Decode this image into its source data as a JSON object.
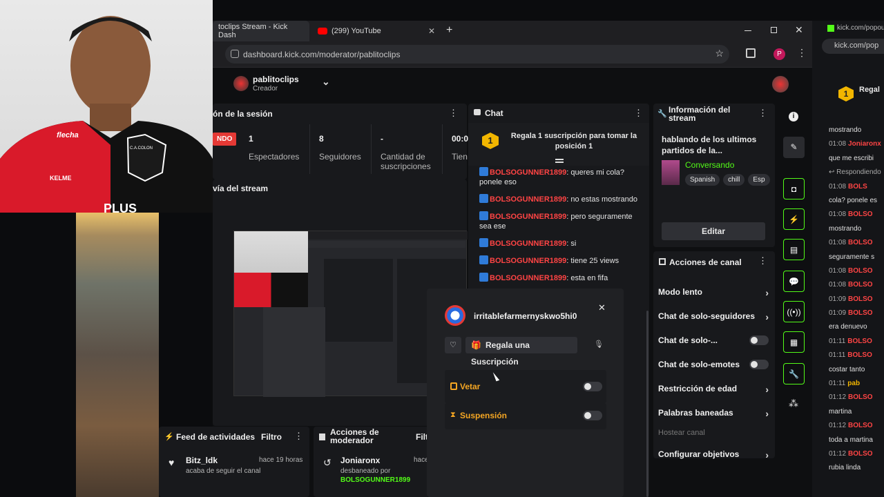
{
  "tabs": [
    {
      "label": "toclips Stream - Kick Dash",
      "close": "✕"
    },
    {
      "label": "(299) YouTube",
      "close": "✕"
    }
  ],
  "new_tab": "+",
  "address": "dashboard.kick.com/moderator/pablitoclips",
  "profile_initial": "P",
  "channel": {
    "name": "pablitoclips",
    "role": "Creador"
  },
  "session": {
    "title": "ón de la sesión",
    "badge": "NDO",
    "stats": [
      {
        "value": "1",
        "label": "Espectadores"
      },
      {
        "value": "8",
        "label": "Seguidores"
      },
      {
        "value": "-",
        "label": "Cantidad de suscripciones"
      },
      {
        "value": "00:0",
        "label": "Tien"
      }
    ]
  },
  "preview_title": "vía del stream",
  "chat": {
    "title": "Chat",
    "pinned": "Regala 1 suscripción para tomar la posición 1",
    "pinned_rank": "1",
    "messages": [
      {
        "user": "BOLSOGUNNER1899",
        "text": ": queres mi cola? ponele eso"
      },
      {
        "user": "BOLSOGUNNER1899",
        "text": ": no estas mostrando"
      },
      {
        "user": "BOLSOGUNNER1899",
        "text": ": pero seguramente sea ese"
      },
      {
        "user": "BOLSOGUNNER1899",
        "text": ": si"
      },
      {
        "user": "BOLSOGUNNER1899",
        "text": ": tiene 25 views"
      },
      {
        "user": "BOLSOGUNNER1899",
        "text": ": esta en fifa"
      }
    ]
  },
  "stream_info": {
    "title": "Información del stream",
    "stream_title": "hablando de los ultimos partidos de la...",
    "category": "Conversando",
    "tags": [
      "Spanish",
      "chill",
      "Esp"
    ],
    "edit_label": "Editar"
  },
  "channel_actions": {
    "title": "Acciones de canal",
    "items": [
      {
        "label": "Modo lento",
        "kind": "chevron"
      },
      {
        "label": "Chat de solo-seguidores",
        "kind": "chevron"
      },
      {
        "label": "Chat de solo-...",
        "kind": "toggle"
      },
      {
        "label": "Chat de solo-emotes",
        "kind": "toggle"
      },
      {
        "label": "Restricción de edad",
        "kind": "chevron"
      },
      {
        "label": "Palabras baneadas",
        "kind": "chevron"
      },
      {
        "label": "Hostear canal",
        "kind": "disabled"
      },
      {
        "label": "Configurar objetivos",
        "kind": "chevron"
      }
    ]
  },
  "activity": {
    "title": "Feed de actividades",
    "filter": "Filtro",
    "user": "Bitz_ldk",
    "time": "hace 19 horas",
    "action": "acaba de seguir el canal"
  },
  "mod_actions": {
    "title": "Acciones de moderador",
    "filter": "Filt",
    "user": "Joniaronx",
    "time": "hace",
    "action": "desbaneado por",
    "by": "BOLSOGUNNER1899"
  },
  "user_modal": {
    "username": "irritablefarmernyskwo5hi0",
    "gift_label": "Regala una Suscripción",
    "veto_label": "Vetar",
    "suspension_label": "Suspensión",
    "close": "✕"
  },
  "right_strip": {
    "url": "kick.com/popou",
    "url2": "kick.com/pop",
    "rank": "1",
    "rank_label": "Regal",
    "lines": [
      {
        "time": "",
        "user": "",
        "text": "mostrando"
      },
      {
        "time": "01:08",
        "user": "Joniaronx",
        "text": ""
      },
      {
        "time": "",
        "user": "",
        "text": "que me escribi"
      },
      {
        "time": "",
        "user": "",
        "text": "↩ Respondiendo"
      },
      {
        "time": "01:08",
        "user": "BOLS",
        "text": ""
      },
      {
        "time": "",
        "user": "",
        "text": "cola? ponele es"
      },
      {
        "time": "01:08",
        "user": "BOLSO",
        "text": ""
      },
      {
        "time": "",
        "user": "",
        "text": "mostrando"
      },
      {
        "time": "01:08",
        "user": "BOLSO",
        "text": ""
      },
      {
        "time": "",
        "user": "",
        "text": "seguramente s"
      },
      {
        "time": "01:08",
        "user": "BOLSO",
        "text": ""
      },
      {
        "time": "01:08",
        "user": "BOLSO",
        "text": ""
      },
      {
        "time": "01:09",
        "user": "BOLSO",
        "text": ""
      },
      {
        "time": "01:09",
        "user": "BOLSO",
        "text": ""
      },
      {
        "time": "",
        "user": "",
        "text": "era denuevo"
      },
      {
        "time": "01:11",
        "user": "BOLSO",
        "text": ""
      },
      {
        "time": "01:11",
        "user": "BOLSO",
        "text": ""
      },
      {
        "time": "",
        "user": "",
        "text": "costar tanto"
      },
      {
        "time": "01:11",
        "user": "pab",
        "text": ""
      },
      {
        "time": "01:12",
        "user": "BOLSO",
        "text": ""
      },
      {
        "time": "",
        "user": "",
        "text": "martina"
      },
      {
        "time": "01:12",
        "user": "BOLSO",
        "text": ""
      },
      {
        "time": "",
        "user": "",
        "text": "toda a martina"
      },
      {
        "time": "01:12",
        "user": "BOLSO",
        "text": ""
      },
      {
        "time": "",
        "user": "",
        "text": "rubia linda"
      }
    ]
  },
  "overlay": {
    "jersey_brand": "KELME",
    "jersey_sponsor": "flecha",
    "crest": "C.A.COLON",
    "sponsor": "PLUS"
  }
}
